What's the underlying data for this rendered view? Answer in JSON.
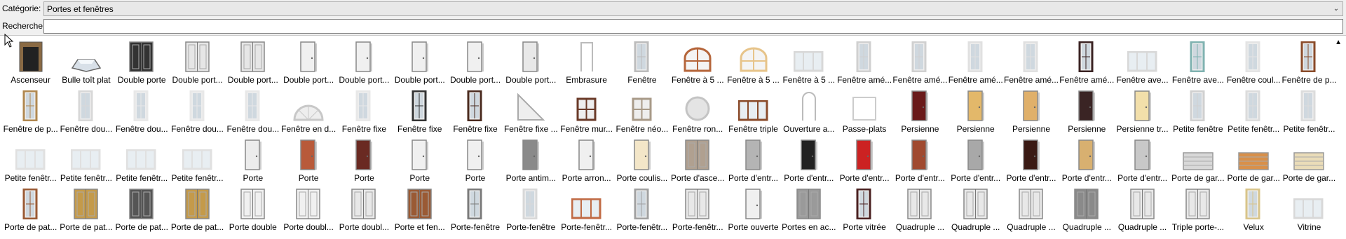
{
  "category": {
    "label": "Catégorie:",
    "value": "Portes et fenêtres"
  },
  "search": {
    "label": "Recherche:",
    "value": ""
  },
  "items": [
    {
      "label": "Ascenseur",
      "kind": "elevator",
      "color": "#8a6a44"
    },
    {
      "label": "Bulle toît plat",
      "kind": "dome",
      "color": "#cfd8e0"
    },
    {
      "label": "Double porte",
      "kind": "door2",
      "color": "#333333"
    },
    {
      "label": "Double port...",
      "kind": "door2",
      "color": "#e6e6e6"
    },
    {
      "label": "Double port...",
      "kind": "door2",
      "color": "#e6e6e6"
    },
    {
      "label": "Double port...",
      "kind": "door",
      "color": "#f0f0f0"
    },
    {
      "label": "Double port...",
      "kind": "door",
      "color": "#f0f0f0"
    },
    {
      "label": "Double port...",
      "kind": "door",
      "color": "#f0f0f0"
    },
    {
      "label": "Double port...",
      "kind": "door",
      "color": "#f0f0f0"
    },
    {
      "label": "Double port...",
      "kind": "door",
      "color": "#e8e8e8"
    },
    {
      "label": "Embrasure",
      "kind": "frame",
      "color": "#ffffff"
    },
    {
      "label": "Fenêtre",
      "kind": "win-tall",
      "color": "#bcbcbc"
    },
    {
      "label": "Fenêtre à 5 ...",
      "kind": "win-arch",
      "color": "#b5653a"
    },
    {
      "label": "Fenêtre à 5 ...",
      "kind": "win-arch",
      "color": "#e7c48a"
    },
    {
      "label": "Fenêtre à 5 ...",
      "kind": "win-wide",
      "color": "#d8d8d8"
    },
    {
      "label": "Fenêtre amé...",
      "kind": "win-tall",
      "color": "#d0d0d0"
    },
    {
      "label": "Fenêtre amé...",
      "kind": "win-tall",
      "color": "#d0d0d0"
    },
    {
      "label": "Fenêtre amé...",
      "kind": "win-tall",
      "color": "#e0e0e0"
    },
    {
      "label": "Fenêtre amé...",
      "kind": "win-tall",
      "color": "#e0e0e0"
    },
    {
      "label": "Fenêtre amé...",
      "kind": "win-tall",
      "color": "#3a2222"
    },
    {
      "label": "Fenêtre ave...",
      "kind": "win-wide",
      "color": "#d8d8d8"
    },
    {
      "label": "Fenêtre ave...",
      "kind": "win-tall",
      "color": "#7fb2b0"
    },
    {
      "label": "Fenêtre coul...",
      "kind": "win-tall",
      "color": "#e4e4e4"
    },
    {
      "label": "Fenêtre de p...",
      "kind": "win-tall",
      "color": "#8a4b2a"
    },
    {
      "label": "Fenêtre de p...",
      "kind": "win-tall",
      "color": "#b08850"
    },
    {
      "label": "Fenêtre dou...",
      "kind": "win-tall",
      "color": "#d8d8d8"
    },
    {
      "label": "Fenêtre dou...",
      "kind": "win-tall",
      "color": "#e8e8e8"
    },
    {
      "label": "Fenêtre dou...",
      "kind": "win-tall",
      "color": "#e8e8e8"
    },
    {
      "label": "Fenêtre dou...",
      "kind": "win-tall",
      "color": "#e8e8e8"
    },
    {
      "label": "Fenêtre en d...",
      "kind": "half-round",
      "color": "#c8c8c8"
    },
    {
      "label": "Fenêtre fixe",
      "kind": "win-tall",
      "color": "#e8e8e8"
    },
    {
      "label": "Fenêtre fixe",
      "kind": "win-tall",
      "color": "#333333"
    },
    {
      "label": "Fenêtre fixe",
      "kind": "win-tall",
      "color": "#4a2a1e"
    },
    {
      "label": "Fenêtre fixe ...",
      "kind": "triangle",
      "color": "#dcdcdc"
    },
    {
      "label": "Fenêtre mur...",
      "kind": "win-square",
      "color": "#6a3a28"
    },
    {
      "label": "Fenêtre néo...",
      "kind": "win-square",
      "color": "#a89a88"
    },
    {
      "label": "Fenêtre ron...",
      "kind": "round",
      "color": "#c4c4c4"
    },
    {
      "label": "Fenêtre triple",
      "kind": "win-wide",
      "color": "#8a4b2a"
    },
    {
      "label": "Ouverture a...",
      "kind": "arch-open",
      "color": "#ffffff"
    },
    {
      "label": "Passe-plats",
      "kind": "frame-sq",
      "color": "#ffffff"
    },
    {
      "label": "Persienne",
      "kind": "door",
      "color": "#6a1a1a"
    },
    {
      "label": "Persienne",
      "kind": "door",
      "color": "#e3b86a"
    },
    {
      "label": "Persienne",
      "kind": "door",
      "color": "#e0b06a"
    },
    {
      "label": "Persienne",
      "kind": "door",
      "color": "#3a2424"
    },
    {
      "label": "Persienne tr...",
      "kind": "door",
      "color": "#f2dfaa"
    },
    {
      "label": "Petite fenêtre",
      "kind": "win-tall",
      "color": "#d0d0d0"
    },
    {
      "label": "Petite fenêtr...",
      "kind": "win-tall",
      "color": "#dcdcdc"
    },
    {
      "label": "Petite fenêtr...",
      "kind": "win-tall",
      "color": "#dcdcdc"
    },
    {
      "label": "Petite fenêtr...",
      "kind": "win-wide",
      "color": "#e0e0e0"
    },
    {
      "label": "Petite fenêtr...",
      "kind": "win-wide",
      "color": "#e0e0e0"
    },
    {
      "label": "Petite fenêtr...",
      "kind": "win-wide",
      "color": "#e0e0e0"
    },
    {
      "label": "Petite fenêtr...",
      "kind": "win-wide",
      "color": "#e0e0e0"
    },
    {
      "label": "Porte",
      "kind": "door",
      "color": "#ececec"
    },
    {
      "label": "Porte",
      "kind": "door",
      "color": "#b85a3a"
    },
    {
      "label": "Porte",
      "kind": "door",
      "color": "#6a2a22"
    },
    {
      "label": "Porte",
      "kind": "door",
      "color": "#f0f0f0"
    },
    {
      "label": "Porte",
      "kind": "door",
      "color": "#f0f0f0"
    },
    {
      "label": "Porte antim...",
      "kind": "door",
      "color": "#8a8a8a"
    },
    {
      "label": "Porte arron...",
      "kind": "door",
      "color": "#f0f0f0"
    },
    {
      "label": "Porte coulis...",
      "kind": "door",
      "color": "#f3e6c8"
    },
    {
      "label": "Porte d'asce...",
      "kind": "door2",
      "color": "#b0a090"
    },
    {
      "label": "Porte d'entr...",
      "kind": "door",
      "color": "#b4b4b4"
    },
    {
      "label": "Porte d'entr...",
      "kind": "door",
      "color": "#222222"
    },
    {
      "label": "Porte d'entr...",
      "kind": "door",
      "color": "#cc2222"
    },
    {
      "label": "Porte d'entr...",
      "kind": "door",
      "color": "#a04a30"
    },
    {
      "label": "Porte d'entr...",
      "kind": "door",
      "color": "#a8a8a8"
    },
    {
      "label": "Porte d'entr...",
      "kind": "door",
      "color": "#3a1a14"
    },
    {
      "label": "Porte d'entr...",
      "kind": "door",
      "color": "#d8b070"
    },
    {
      "label": "Porte d'entr...",
      "kind": "door",
      "color": "#c8c8c8"
    },
    {
      "label": "Porte de gar...",
      "kind": "garage",
      "color": "#d8d8d8"
    },
    {
      "label": "Porte de gar...",
      "kind": "garage",
      "color": "#d8904a"
    },
    {
      "label": "Porte de gar...",
      "kind": "garage",
      "color": "#eadcb8"
    },
    {
      "label": "Porte de pat...",
      "kind": "win-tall",
      "color": "#9a5a34"
    },
    {
      "label": "Porte de pat...",
      "kind": "door2",
      "color": "#c49a4a"
    },
    {
      "label": "Porte de pat...",
      "kind": "door2",
      "color": "#555555"
    },
    {
      "label": "Porte de pat...",
      "kind": "door2",
      "color": "#c49a4a"
    },
    {
      "label": "Porte double",
      "kind": "door2",
      "color": "#f0f0f0"
    },
    {
      "label": "Porte doubl...",
      "kind": "door2",
      "color": "#f0f0f0"
    },
    {
      "label": "Porte doubl...",
      "kind": "door2",
      "color": "#e8e8e8"
    },
    {
      "label": "Porte et fen...",
      "kind": "door2",
      "color": "#9a5a34"
    },
    {
      "label": "Porte-fenêtre",
      "kind": "win-tall",
      "color": "#7a7a7a"
    },
    {
      "label": "Porte-fenêtre",
      "kind": "win-tall",
      "color": "#d8d8d8"
    },
    {
      "label": "Porte-fenêtr...",
      "kind": "win-wide",
      "color": "#c06a44"
    },
    {
      "label": "Porte-fenêtr...",
      "kind": "win-tall",
      "color": "#a0a0a0"
    },
    {
      "label": "Porte-fenêtr...",
      "kind": "door2",
      "color": "#e8e8e8"
    },
    {
      "label": "Porte ouverte",
      "kind": "door",
      "color": "#f0f0f0"
    },
    {
      "label": "Portes en ac...",
      "kind": "door2",
      "color": "#9a9a9a"
    },
    {
      "label": "Porte vitrée",
      "kind": "win-tall",
      "color": "#4a2020"
    },
    {
      "label": "Quadruple ...",
      "kind": "door2",
      "color": "#e8e8e8"
    },
    {
      "label": "Quadruple ...",
      "kind": "door2",
      "color": "#e8e8e8"
    },
    {
      "label": "Quadruple ...",
      "kind": "door2",
      "color": "#e8e8e8"
    },
    {
      "label": "Quadruple ...",
      "kind": "door2",
      "color": "#8a8a8a"
    },
    {
      "label": "Quadruple ...",
      "kind": "door2",
      "color": "#e8e8e8"
    },
    {
      "label": "Triple porte-...",
      "kind": "door2",
      "color": "#e8e8e8"
    },
    {
      "label": "Velux",
      "kind": "win-tall",
      "color": "#d8c48a"
    },
    {
      "label": "Vitrine",
      "kind": "win-wide",
      "color": "#d8d8d8"
    }
  ]
}
